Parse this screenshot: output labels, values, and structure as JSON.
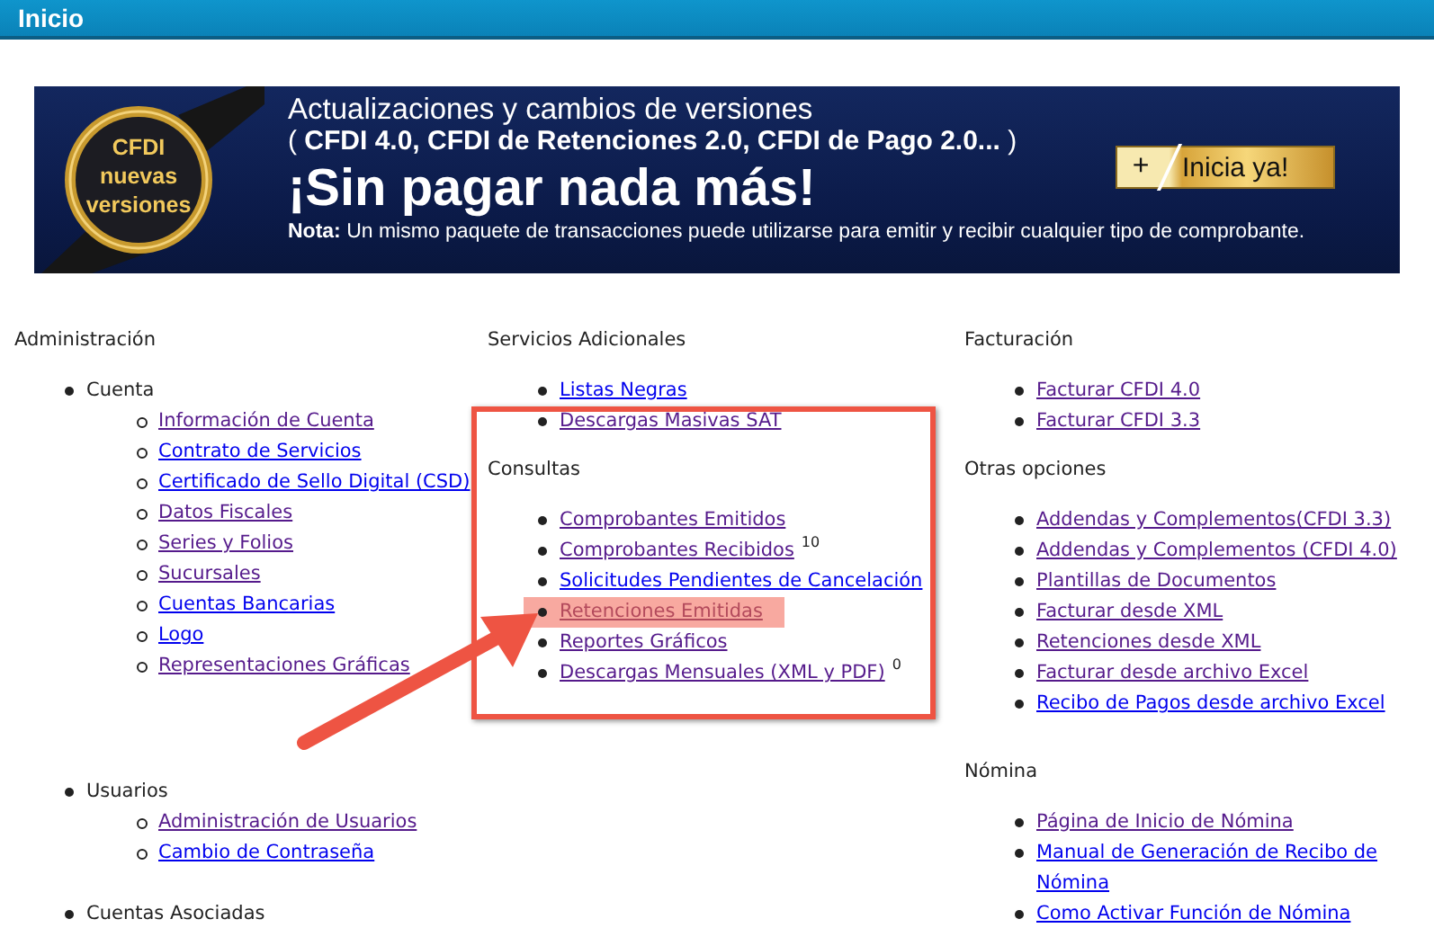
{
  "header": {
    "title": "Inicio"
  },
  "banner": {
    "badge_lines": [
      "CFDI",
      "nuevas",
      "versiones"
    ],
    "line_1": "Actualizaciones y cambios de versiones",
    "line_2": "( **CFDI 4.0, CFDI de Retenciones 2.0, CFDI de Pago 2.0...** )",
    "headline": "¡Sin pagar nada más!",
    "note": "**Nota:** Un mismo paquete de transacciones puede utilizarse para emitir y recibir cualquier tipo de comprobante.",
    "button": {
      "icon": "+",
      "label": "Inicia ya!"
    }
  },
  "rows": [
    {
      "cells": [
        {
          "sections": [
            {
              "heading": "Administración",
              "items": [
                {
                  "kind": "group",
                  "label": "Cuenta",
                  "children": [
                    {
                      "kind": "link",
                      "label": "Información de Cuenta",
                      "visited": true
                    },
                    {
                      "kind": "link",
                      "label": "Contrato de Servicios",
                      "visited": false
                    },
                    {
                      "kind": "link",
                      "label": "Certificado de Sello Digital (CSD)",
                      "visited": false
                    },
                    {
                      "kind": "link",
                      "label": "Datos Fiscales",
                      "visited": true
                    },
                    {
                      "kind": "link",
                      "label": "Series y Folios",
                      "visited": true
                    },
                    {
                      "kind": "link",
                      "label": "Sucursales",
                      "visited": true
                    },
                    {
                      "kind": "link",
                      "label": "Cuentas Bancarias",
                      "visited": false
                    },
                    {
                      "kind": "link",
                      "label": "Logo",
                      "visited": false
                    },
                    {
                      "kind": "link",
                      "label": "Representaciones Gráficas",
                      "visited": true
                    }
                  ]
                }
              ]
            }
          ]
        },
        {
          "sections": [
            {
              "heading": "Servicios Adicionales",
              "items": [
                {
                  "kind": "link",
                  "label": "Listas Negras",
                  "visited": false
                },
                {
                  "kind": "link",
                  "label": "Descargas Masivas SAT",
                  "visited": true
                }
              ]
            },
            {
              "heading": "Consultas",
              "framed": true,
              "items": [
                {
                  "kind": "link",
                  "label": "Comprobantes Emitidos",
                  "visited": true
                },
                {
                  "kind": "link",
                  "label": "Comprobantes Recibidos",
                  "visited": true,
                  "count": "10"
                },
                {
                  "kind": "link",
                  "label": "Solicitudes Pendientes de Cancelación",
                  "visited": false
                },
                {
                  "kind": "link",
                  "label": "Retenciones Emitidas",
                  "visited": true,
                  "highlighted": true
                },
                {
                  "kind": "link",
                  "label": "Reportes Gráficos",
                  "visited": true
                },
                {
                  "kind": "link",
                  "label": "Descargas Mensuales (XML y PDF)",
                  "visited": true,
                  "count": "0"
                }
              ]
            }
          ]
        },
        {
          "sections": [
            {
              "heading": "Facturación",
              "items": [
                {
                  "kind": "link",
                  "label": "Facturar CFDI 4.0",
                  "visited": true
                },
                {
                  "kind": "link",
                  "label": "Facturar CFDI 3.3",
                  "visited": true
                }
              ]
            },
            {
              "heading": "Otras opciones",
              "items": [
                {
                  "kind": "link",
                  "label": "Addendas y Complementos(CFDI 3.3)",
                  "visited": true
                },
                {
                  "kind": "link",
                  "label": "Addendas y Complementos (CFDI 4.0)",
                  "visited": true
                },
                {
                  "kind": "link",
                  "label": "Plantillas de Documentos",
                  "visited": true
                },
                {
                  "kind": "link",
                  "label": "Facturar desde XML",
                  "visited": true
                },
                {
                  "kind": "link",
                  "label": "Retenciones desde XML",
                  "visited": true
                },
                {
                  "kind": "link",
                  "label": "Facturar desde archivo Excel",
                  "visited": true
                },
                {
                  "kind": "link",
                  "label": "Recibo de Pagos desde archivo Excel",
                  "visited": false
                }
              ]
            }
          ]
        }
      ]
    },
    {
      "cells": [
        {
          "sections": [
            {
              "items": [
                {
                  "kind": "group",
                  "label": "Usuarios",
                  "children": [
                    {
                      "kind": "link",
                      "label": "Administración de Usuarios",
                      "visited": true
                    },
                    {
                      "kind": "link",
                      "label": "Cambio de Contraseña",
                      "visited": false
                    }
                  ]
                },
                {
                  "kind": "group",
                  "label": "Cuentas Asociadas"
                }
              ]
            }
          ]
        },
        {},
        {
          "sections": [
            {
              "heading": "Nómina",
              "items": [
                {
                  "kind": "link",
                  "label": "Página de Inicio de Nómina",
                  "visited": true
                },
                {
                  "kind": "link",
                  "label": "Manual de Generación de Recibo de Nómina",
                  "visited": false
                },
                {
                  "kind": "link",
                  "label": "Como Activar Función de Nómina",
                  "visited": false
                }
              ]
            }
          ]
        }
      ]
    }
  ]
}
